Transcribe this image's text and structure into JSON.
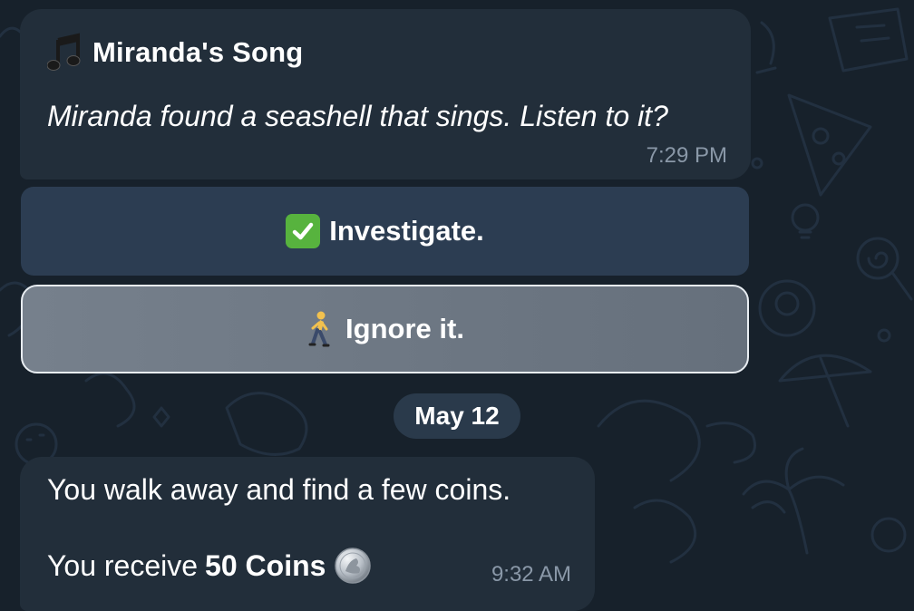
{
  "colors": {
    "background": "#17212b",
    "bubble": "#222e3a",
    "button_primary": "#2c3d52",
    "button_selected": "#6e7884",
    "timestamp": "#8a98a8",
    "check_green": "#57b33e"
  },
  "message_1": {
    "icon": "musical-notes-icon",
    "title": "Miranda's Song",
    "body": "Miranda found a seashell that sings. Listen to it?",
    "time": "7:29 PM"
  },
  "buttons": [
    {
      "icon": "check-mark-icon",
      "label": "Investigate."
    },
    {
      "icon": "person-walking-icon",
      "label": "Ignore it.",
      "selected": true
    }
  ],
  "date_separator": "May 12",
  "message_2": {
    "line1": "You walk away and find a few coins.",
    "line2_prefix": "You receive",
    "line2_bold": "50 Coins",
    "icon": "coin-icon",
    "time": "9:32 AM"
  }
}
